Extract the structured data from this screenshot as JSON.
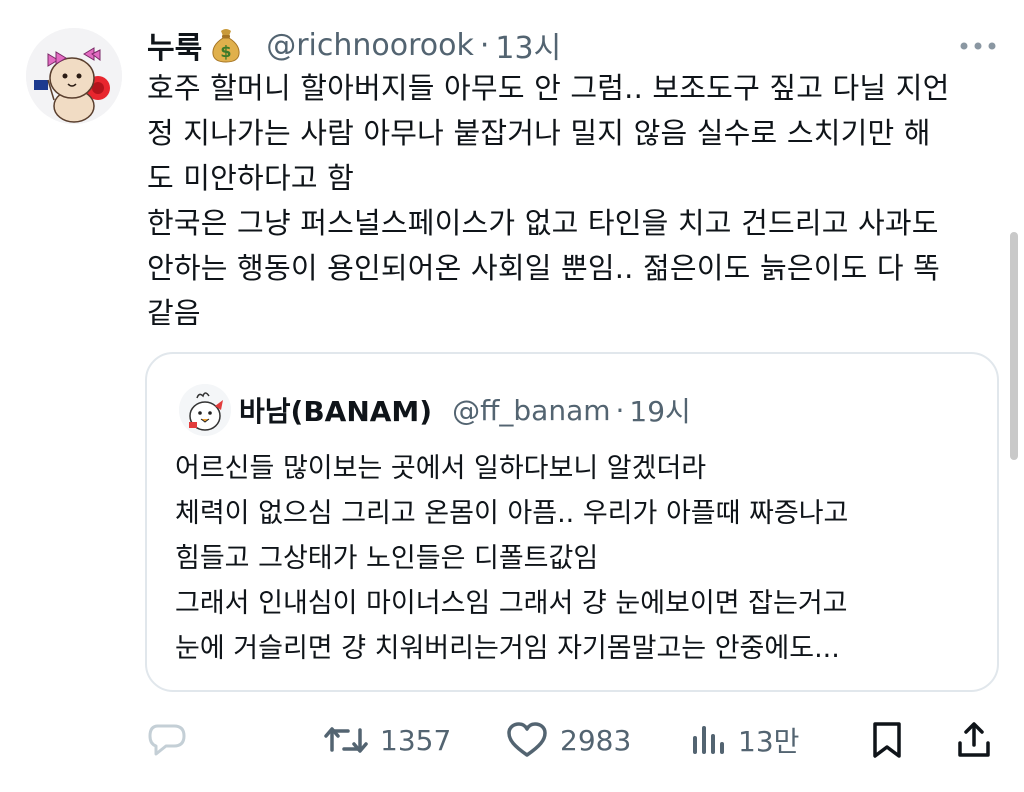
{
  "tweet": {
    "author_name": "누룩",
    "author_emoji": "money-bag-icon",
    "handle": "@richnoorook",
    "separator": "·",
    "time": "13시",
    "text_lines": [
      "호주 할머니 할아버지들 아무도 안 그럼.. 보조도구 짚고 다닐 지언",
      "정 지나가는 사람 아무나 붙잡거나 밀지 않음 실수로 스치기만 해",
      "도 미안하다고 함",
      "한국은 그냥 퍼스널스페이스가 없고 타인을 치고 건드리고 사과도",
      "안하는 행동이 용인되어온 사회일 뿐임.. 젊은이도 늙은이도 다 똑",
      "같음"
    ]
  },
  "quote": {
    "author_name": "바남(BANAM)",
    "handle": "@ff_banam",
    "separator": "·",
    "time": "19시",
    "text_lines": [
      "어르신들 많이보는 곳에서 일하다보니 알겠더라",
      "체력이 없으심 그리고 온몸이 아픔.. 우리가 아플때 짜증나고",
      "힘들고 그상태가 노인들은 디폴트값임",
      "그래서 인내심이 마이너스임 그래서 걍 눈에보이면 잡는거고",
      "눈에 거슬리면 걍 치워버리는거임 자기몸말고는 안중에도..."
    ]
  },
  "actions": {
    "retweet_count": "1357",
    "like_count": "2983",
    "view_count": "13만"
  },
  "colors": {
    "text": "#0f1419",
    "secondary": "#536471",
    "border": "#e1e7ec",
    "reply_icon": "#c4cfd6"
  }
}
